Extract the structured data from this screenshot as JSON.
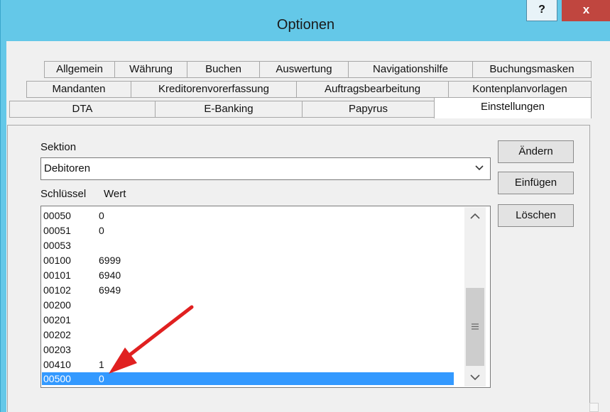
{
  "window": {
    "title": "Optionen",
    "help_label": "?",
    "close_label": "x"
  },
  "tabs": {
    "row1": [
      "Allgemein",
      "Währung",
      "Buchen",
      "Auswertung",
      "Navigationshilfe",
      "Buchungsmasken"
    ],
    "row2": [
      "Mandanten",
      "Kreditorenvorerfassung",
      "Auftragsbearbeitung",
      "Kontenplanvorlagen"
    ],
    "row3": [
      "DTA",
      "E-Banking",
      "Papyrus",
      "Einstellungen"
    ],
    "active": "Einstellungen"
  },
  "form": {
    "section_label": "Sektion",
    "section_value": "Debitoren",
    "key_header": "Schlüssel",
    "value_header": "Wert"
  },
  "list": [
    {
      "key": "00050",
      "value": "0"
    },
    {
      "key": "00051",
      "value": "0"
    },
    {
      "key": "00053",
      "value": ""
    },
    {
      "key": "00100",
      "value": "6999"
    },
    {
      "key": "00101",
      "value": "6940"
    },
    {
      "key": "00102",
      "value": "6949"
    },
    {
      "key": "00200",
      "value": ""
    },
    {
      "key": "00201",
      "value": ""
    },
    {
      "key": "00202",
      "value": ""
    },
    {
      "key": "00203",
      "value": ""
    },
    {
      "key": "00410",
      "value": "1"
    },
    {
      "key": "00500",
      "value": "0",
      "selected": true
    }
  ],
  "buttons": {
    "change": "Ändern",
    "insert": "Einfügen",
    "delete": "Löschen"
  },
  "colors": {
    "titlebar": "#64c8e8",
    "close": "#c0463f",
    "selection": "#3399ff",
    "arrow": "#e02020"
  },
  "icons": {
    "dropdown": "chevron-down-icon",
    "scroll_up": "chevron-up-icon",
    "scroll_down": "chevron-down-icon",
    "grip": "grip-icon"
  }
}
